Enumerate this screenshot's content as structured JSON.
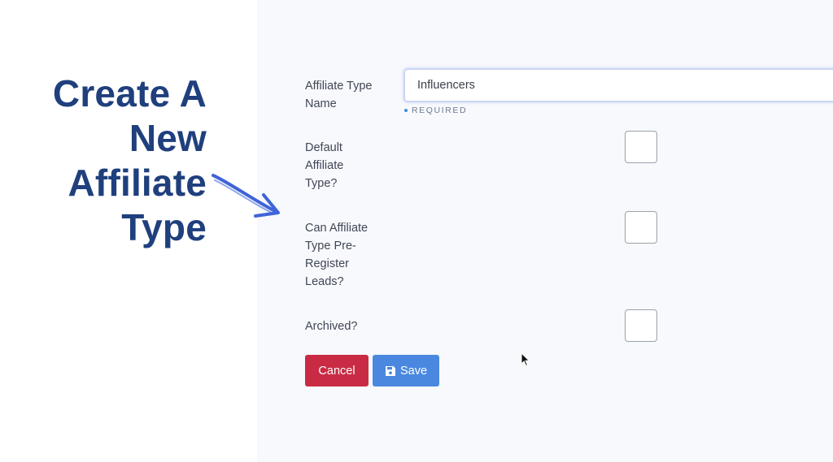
{
  "promo": {
    "lines": [
      "Create A",
      "New",
      "Affiliate",
      "Type"
    ],
    "color": "#1f3f7d",
    "arrow_color": "#3f63d8"
  },
  "form": {
    "name_label": "Affiliate Type Name",
    "name_value": "Influencers",
    "required_text": "REQUIRED",
    "default_label": "Default Affiliate Type?",
    "default_checked": false,
    "preregister_label": "Can Affiliate Type Pre-Register Leads?",
    "preregister_checked": false,
    "archived_label": "Archived?",
    "archived_checked": false
  },
  "buttons": {
    "cancel_label": "Cancel",
    "save_label": "Save",
    "save_icon": "floppy-disk-icon",
    "cancel_color": "#c92b45",
    "save_color": "#4a88e0"
  }
}
